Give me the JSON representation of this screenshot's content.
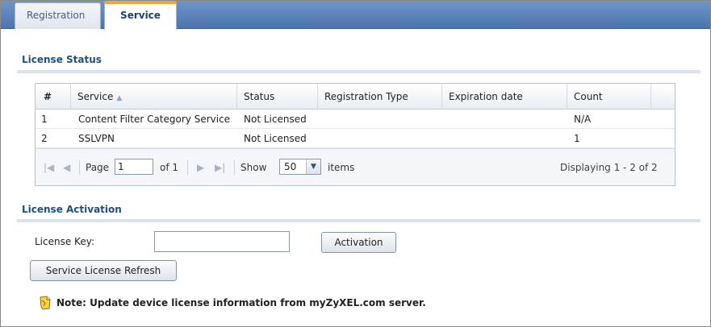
{
  "tabs": [
    {
      "label": "Registration",
      "active": false
    },
    {
      "label": "Service",
      "active": true
    }
  ],
  "license_status": {
    "title": "License Status",
    "columns": [
      "#",
      "Service",
      "Status",
      "Registration Type",
      "Expiration date",
      "Count"
    ],
    "rows": [
      {
        "num": "1",
        "service": "Content Filter Category Service",
        "status": "Not Licensed",
        "registration_type": "",
        "expiration": "",
        "count": "N/A"
      },
      {
        "num": "2",
        "service": "SSLVPN",
        "status": "Not Licensed",
        "registration_type": "",
        "expiration": "",
        "count": "1"
      }
    ],
    "pager": {
      "page_label": "Page",
      "page_value": "1",
      "of_label": "of 1",
      "show_label": "Show",
      "show_value": "50",
      "items_label": "items",
      "displaying": "Displaying 1 - 2 of 2"
    }
  },
  "license_activation": {
    "title": "License Activation",
    "key_label": "License Key:",
    "key_value": "",
    "activation_button": "Activation",
    "refresh_button": "Service License Refresh"
  },
  "note": "Note: Update device license information from myZyXEL.com server.",
  "colors": {
    "tab_bar": "#4c74ad",
    "section_title": "#1f4e86",
    "active_tab_accent": "#f2a33a"
  }
}
